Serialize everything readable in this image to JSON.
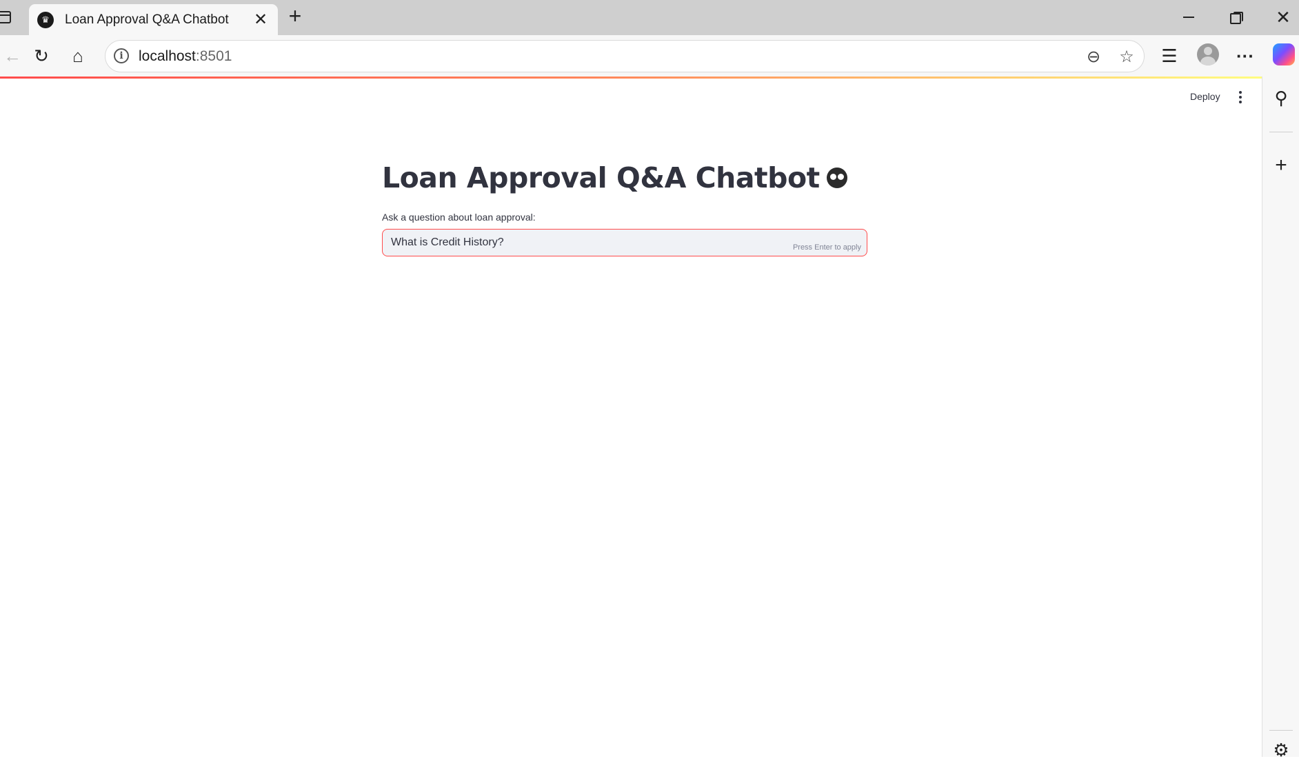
{
  "browser": {
    "tab": {
      "title": "Loan Approval Q&A Chatbot",
      "favicon": "streamlit-crown-icon"
    },
    "address": {
      "host": "localhost",
      "port": ":8501"
    }
  },
  "app": {
    "toolbar": {
      "deploy_label": "Deploy"
    },
    "title": "Loan Approval Q&A Chatbot",
    "question": {
      "label": "Ask a question about loan approval:",
      "value": "What is Credit History?",
      "hint": "Press Enter to apply"
    }
  },
  "colors": {
    "accent": "#ff4b4b",
    "text": "#31333f",
    "input_bg": "#f0f2f6"
  }
}
